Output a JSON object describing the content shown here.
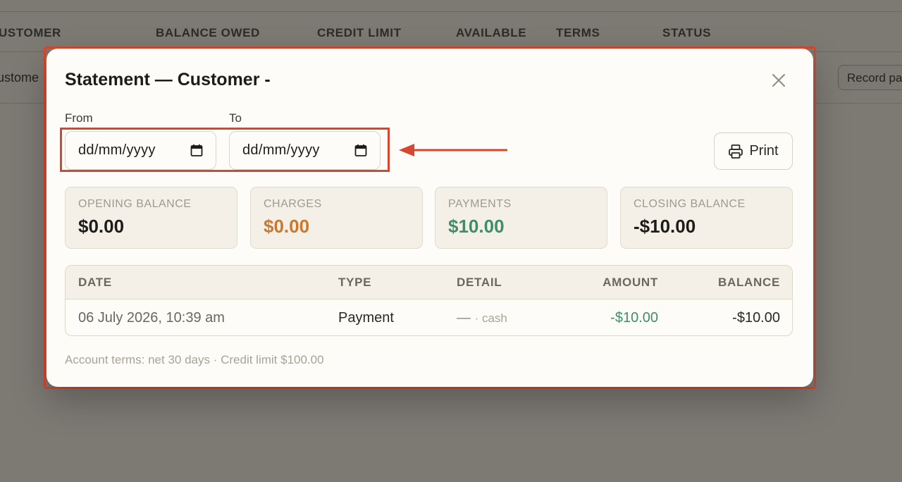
{
  "background": {
    "table_headers": [
      "USTOMER",
      "BALANCE OWED",
      "CREDIT LIMIT",
      "AVAILABLE",
      "TERMS",
      "STATUS"
    ],
    "row_customer": "ustome",
    "record_button_label": "Record pa"
  },
  "modal": {
    "title": "Statement — Customer -",
    "from_label": "From",
    "to_label": "To",
    "from_placeholder": "dd/mm/yyyy",
    "to_placeholder": "dd/mm/yyyy",
    "print_label": "Print"
  },
  "stats": [
    {
      "label": "OPENING BALANCE",
      "value": "$0.00",
      "color": "#1e1c19"
    },
    {
      "label": "CHARGES",
      "value": "$0.00",
      "color": "#c8782f"
    },
    {
      "label": "PAYMENTS",
      "value": "$10.00",
      "color": "#3f8f66"
    },
    {
      "label": "CLOSING BALANCE",
      "value": "-$10.00",
      "color": "#1e1c19"
    }
  ],
  "table": {
    "headers": {
      "date": "DATE",
      "type": "TYPE",
      "detail": "DETAIL",
      "amount": "AMOUNT",
      "balance": "BALANCE"
    },
    "rows": [
      {
        "date": "06 July 2026, 10:39 am",
        "type": "Payment",
        "detail_dash": "—",
        "detail_method": "· cash",
        "amount": "-$10.00",
        "balance": "-$10.00"
      }
    ]
  },
  "footer_note": "Account terms: net 30 days · Credit limit $100.00",
  "colors": {
    "highlight": "#d7472f",
    "payment_amount": "#3f8f66"
  }
}
